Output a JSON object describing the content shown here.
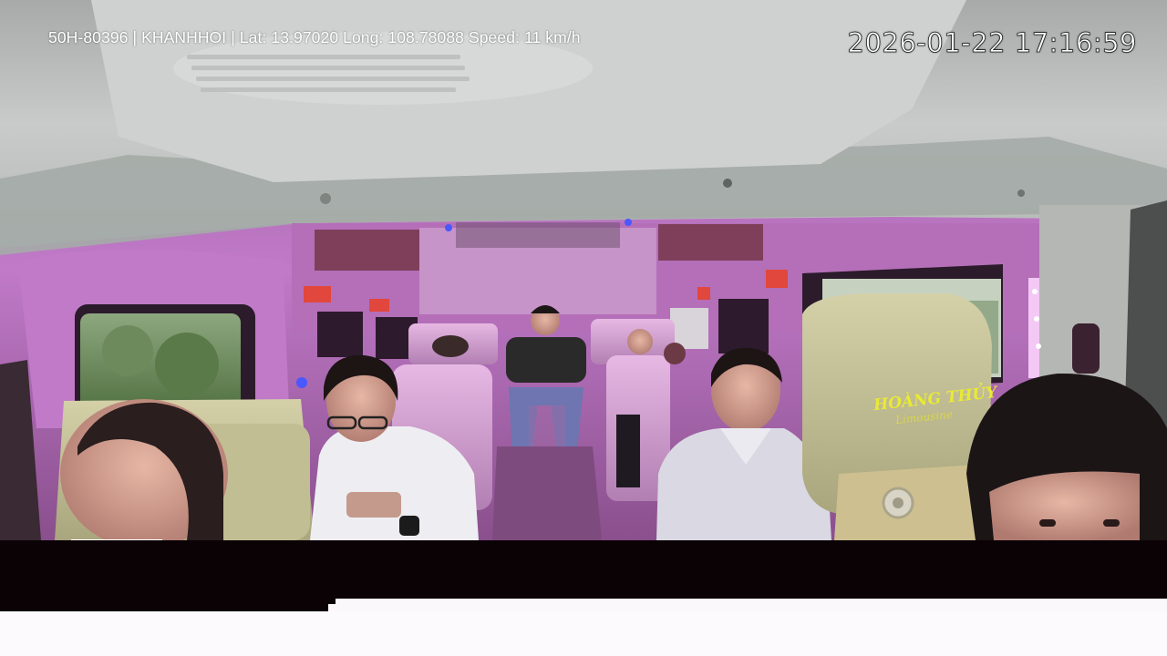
{
  "overlay": {
    "info_text": "50H-80396 | KHANHHOI | Lat: 13.97020 Long: 108.78088 Speed: 11 km/h",
    "timestamp": "2026-01-22 17:16:59"
  },
  "seat_branding": {
    "logo": "HOÀNG THỦY",
    "sub": "Limousine"
  },
  "colors": {
    "cabin_lighting": "#b86cc0",
    "ceiling": "#c4c7c5",
    "seat_leather": "#c8c49a",
    "logo_yellow": "#e9ea33",
    "bottom_band": "#0b0206"
  }
}
